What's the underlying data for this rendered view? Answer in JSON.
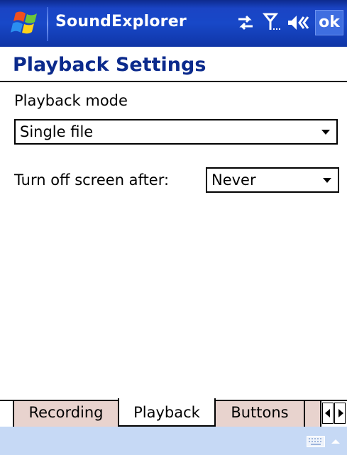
{
  "titlebar": {
    "app_title": "SoundExplorer",
    "ok_label": "ok",
    "icons": [
      "windows-start-icon",
      "connectivity-icon",
      "signal-icon",
      "volume-muted-icon"
    ]
  },
  "page": {
    "title": "Playback Settings"
  },
  "form": {
    "playback_mode_label": "Playback mode",
    "playback_mode_value": "Single file",
    "screen_off_label": "Turn off screen after:",
    "screen_off_value": "Never"
  },
  "tabs": [
    {
      "label": "Recording",
      "active": false
    },
    {
      "label": "Playback",
      "active": true
    },
    {
      "label": "Buttons",
      "active": false
    }
  ],
  "menubar": {
    "icons": [
      "keyboard-icon",
      "input-menu-arrow-icon"
    ]
  },
  "colors": {
    "titlebar_blue": "#1848c8",
    "heading_blue": "#0b2a8c",
    "inactive_tab": "#e8d3ce",
    "menubar": "#c6d9f5"
  }
}
